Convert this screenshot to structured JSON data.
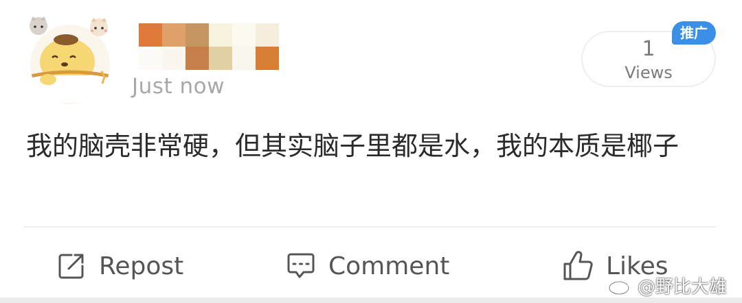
{
  "post": {
    "timestamp": "Just now",
    "views_count": "1",
    "views_label": "Views",
    "ad_badge": "推广",
    "text": "我的脑壳非常硬，但其实脑子里都是水，我的本质是椰子"
  },
  "actions": {
    "repost": "Repost",
    "comment": "Comment",
    "likes": "Likes"
  },
  "watermark": "@野比大雄",
  "icons": {
    "repost": "repost-icon",
    "comment": "comment-icon",
    "likes": "thumbs-up-icon",
    "watermark": "weibo-logo-icon"
  },
  "colors": {
    "ad_badge": "#3b8fe6",
    "text": "#2a2a2a",
    "muted": "#a8a8a8",
    "icon": "#555555"
  }
}
